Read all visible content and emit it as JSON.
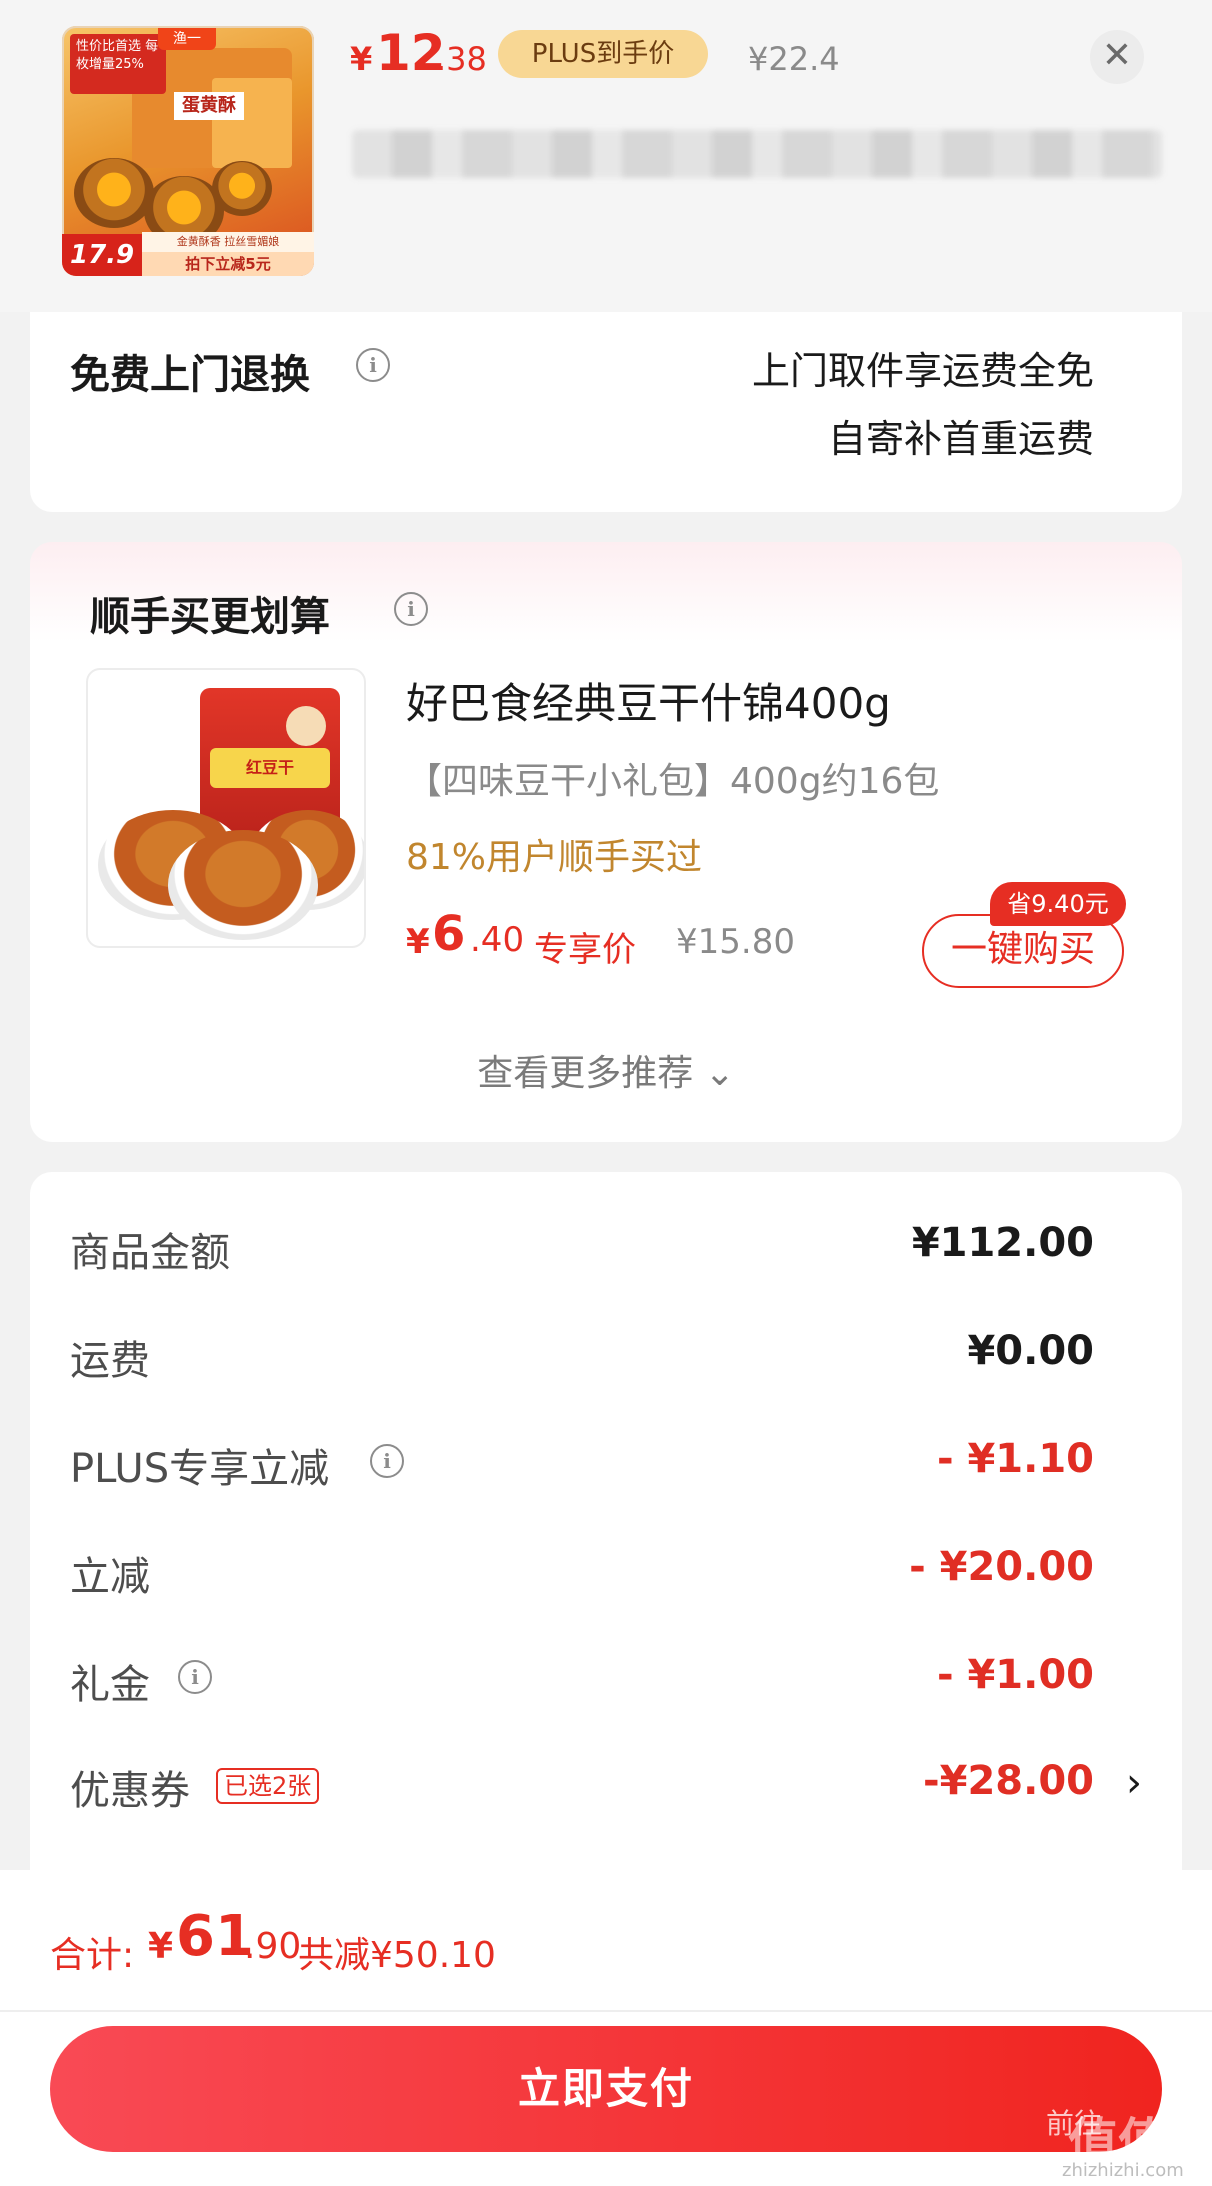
{
  "header": {
    "thumb": {
      "logo": "渔一",
      "tag": "性价比首选 每枚增量25%",
      "brand": "蛋黄酥",
      "price": "17.9",
      "sub1": "金黄酥香 拉丝雪媚娘",
      "sub2": "拍下立减5元"
    },
    "price_symbol": "¥",
    "price_int": "12",
    "price_dec": ".38",
    "plus_badge": "PLUS到手价",
    "original_price": "¥22.4",
    "close_icon": "✕"
  },
  "return_service": {
    "title": "免费上门退换",
    "line1": "上门取件享运费全免",
    "line2": "自寄补首重运费"
  },
  "recommend": {
    "title": "顺手买更划算",
    "image_label": "红豆干",
    "product_name": "好巴食经典豆干什锦400g",
    "spec": "【四味豆干小礼包】400g约16包",
    "users": "81%用户顺手买过",
    "price_symbol": "¥",
    "price_int": "6",
    "price_dec": ".40",
    "exclusive": "专享价",
    "original_price": "¥15.80",
    "save_badge": "省9.40元",
    "buy_button": "一键购买",
    "more": "查看更多推荐 ⌄"
  },
  "summary": {
    "rows": [
      {
        "label": "商品金额",
        "value": "¥112.00"
      },
      {
        "label": "运费",
        "value": "¥0.00"
      },
      {
        "label": "PLUS专享立减",
        "value": "- ¥1.10"
      },
      {
        "label": "立减",
        "value": "- ¥20.00"
      },
      {
        "label": "礼金",
        "value": "- ¥1.00"
      },
      {
        "label": "优惠券",
        "value": "-¥28.00"
      }
    ],
    "coupon_tag": "已选2张",
    "chevron": "›"
  },
  "bottom": {
    "total_label": "合计:",
    "total_symbol": "¥",
    "total_int": "61",
    "total_dec": ".90",
    "total_saved": "共减¥50.10",
    "pay_button": "立即支付",
    "watermark_1": "前往",
    "watermark_2": "值值值",
    "watermark_3": "zhizhizhi.com"
  },
  "colors": {
    "accent_red": "#e62e23",
    "plus_gold": "#f8d794",
    "gold_text": "#c1862e"
  }
}
